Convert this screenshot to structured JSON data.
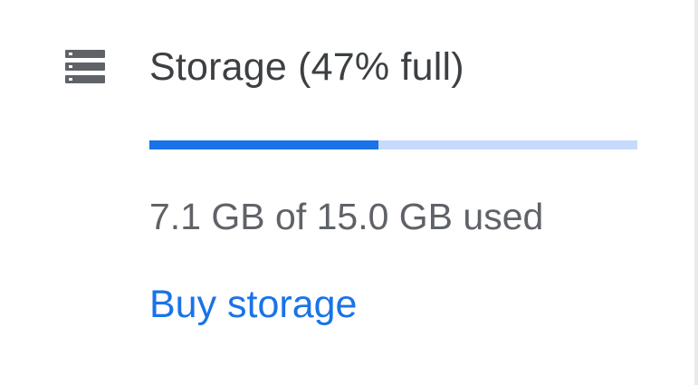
{
  "storage": {
    "icon": "storage-icon",
    "title": "Storage (47% full)",
    "used_fraction": 0.47,
    "usage_text": "7.1 GB of 15.0 GB used",
    "buy_label": "Buy storage"
  },
  "colors": {
    "accent": "#1a73e8",
    "bar_track": "#c6dafc",
    "title_text": "#3c4043",
    "secondary_text": "#5f6368",
    "icon": "#5f6368"
  }
}
